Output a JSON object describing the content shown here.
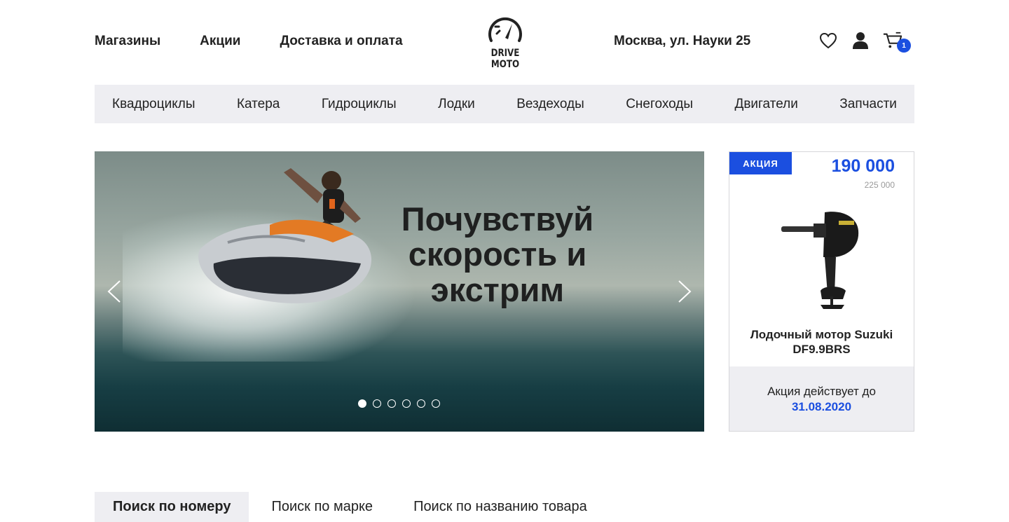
{
  "header": {
    "nav": [
      "Магазины",
      "Акции",
      "Доставка и оплата"
    ],
    "logo_text": "DRIVE MOTO",
    "address": "Москва, ул. Науки 25",
    "icons": [
      "heart-icon",
      "user-icon",
      "cart-icon"
    ],
    "cart_count": "1"
  },
  "categories": [
    "Квадроциклы",
    "Катера",
    "Гидроциклы",
    "Лодки",
    "Вездеходы",
    "Снегоходы",
    "Двигатели",
    "Запчасти"
  ],
  "hero": {
    "title_line1": "Почувствуй",
    "title_line2": "скорость и",
    "title_line3": "экстрим",
    "slides": 6,
    "active_slide": 1
  },
  "promo": {
    "badge": "АКЦИЯ",
    "price": "190 000",
    "old_price": "225 000",
    "product_name_line1": "Лодочный мотор Suzuki",
    "product_name_line2": "DF9.9BRS",
    "valid_label": "Акция действует до",
    "valid_date": "31.08.2020"
  },
  "search_tabs": [
    "Поиск по номеру",
    "Поиск по марке",
    "Поиск по названию товара"
  ],
  "colors": {
    "accent": "#1b4fe0",
    "bar_bg": "#eeeef2",
    "text": "#222222"
  }
}
